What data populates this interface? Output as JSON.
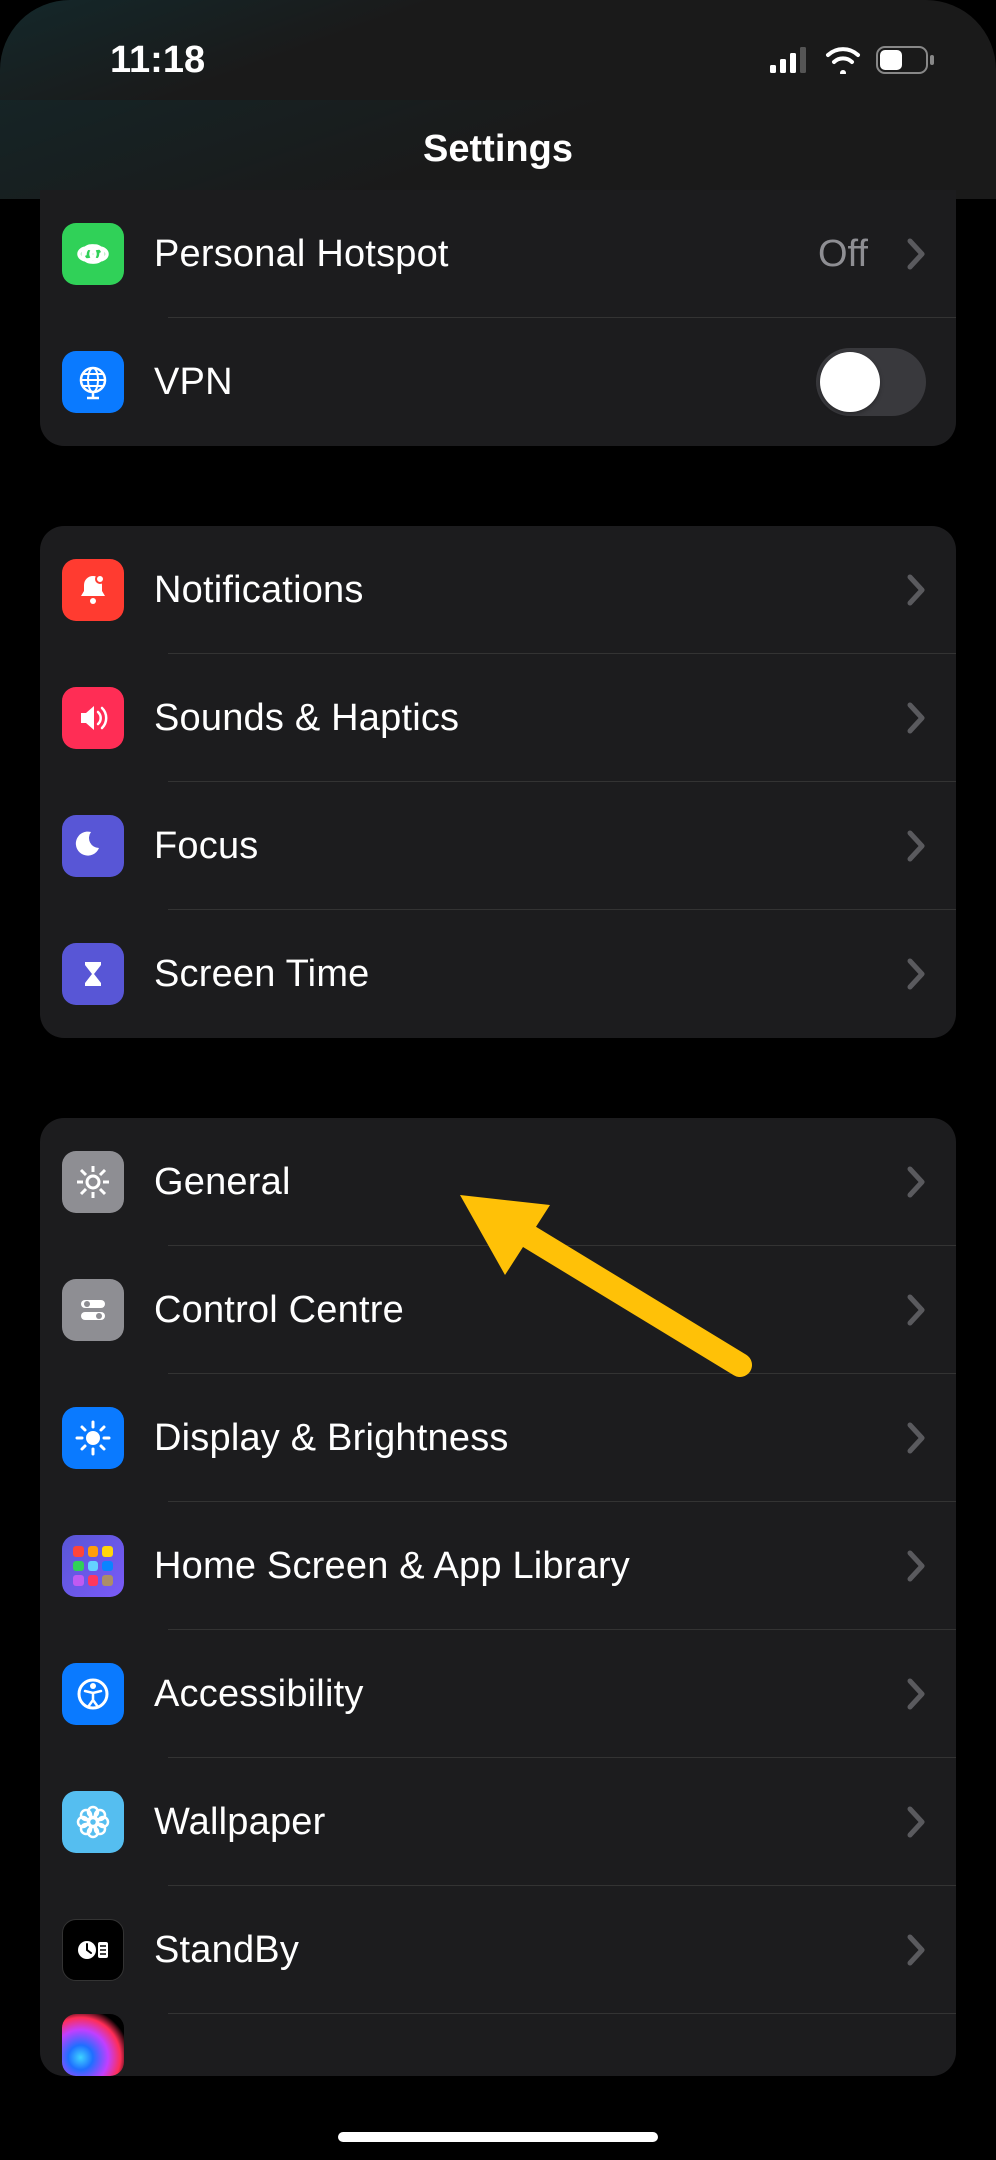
{
  "status": {
    "time": "11:18"
  },
  "header": {
    "title": "Settings"
  },
  "groups": [
    {
      "id": "net",
      "rows": [
        {
          "id": "personal-hotspot",
          "label": "Personal Hotspot",
          "detail": "Off",
          "type": "nav",
          "icon": "link-icon",
          "iconBg": "bg-green"
        },
        {
          "id": "vpn",
          "label": "VPN",
          "type": "toggle",
          "toggleOn": false,
          "icon": "globe-icon",
          "iconBg": "bg-blue"
        }
      ]
    },
    {
      "id": "notify",
      "rows": [
        {
          "id": "notifications",
          "label": "Notifications",
          "type": "nav",
          "icon": "bell-icon",
          "iconBg": "bg-red"
        },
        {
          "id": "sounds-haptics",
          "label": "Sounds & Haptics",
          "type": "nav",
          "icon": "speaker-icon",
          "iconBg": "bg-pink"
        },
        {
          "id": "focus",
          "label": "Focus",
          "type": "nav",
          "icon": "moon-icon",
          "iconBg": "bg-indigo"
        },
        {
          "id": "screen-time",
          "label": "Screen Time",
          "type": "nav",
          "icon": "hourglass-icon",
          "iconBg": "bg-indigo"
        }
      ]
    },
    {
      "id": "system",
      "rows": [
        {
          "id": "general",
          "label": "General",
          "type": "nav",
          "icon": "gear-icon",
          "iconBg": "bg-gray"
        },
        {
          "id": "control-centre",
          "label": "Control Centre",
          "type": "nav",
          "icon": "switches-icon",
          "iconBg": "bg-gray"
        },
        {
          "id": "display-brightness",
          "label": "Display & Brightness",
          "type": "nav",
          "icon": "sun-icon",
          "iconBg": "bg-darkblue"
        },
        {
          "id": "home-screen",
          "label": "Home Screen & App Library",
          "type": "nav",
          "icon": "appgrid-icon",
          "iconBg": "bg-gradhome"
        },
        {
          "id": "accessibility",
          "label": "Accessibility",
          "type": "nav",
          "icon": "accessibility-icon",
          "iconBg": "bg-darkblue"
        },
        {
          "id": "wallpaper",
          "label": "Wallpaper",
          "type": "nav",
          "icon": "flower-icon",
          "iconBg": "bg-cyan"
        },
        {
          "id": "standby",
          "label": "StandBy",
          "type": "nav",
          "icon": "standby-icon",
          "iconBg": "bg-black"
        },
        {
          "id": "siri-search",
          "label": "",
          "type": "nav",
          "icon": "siri-icon",
          "iconBg": "bg-siri"
        }
      ]
    }
  ],
  "annotation": {
    "arrowTarget": "general"
  }
}
